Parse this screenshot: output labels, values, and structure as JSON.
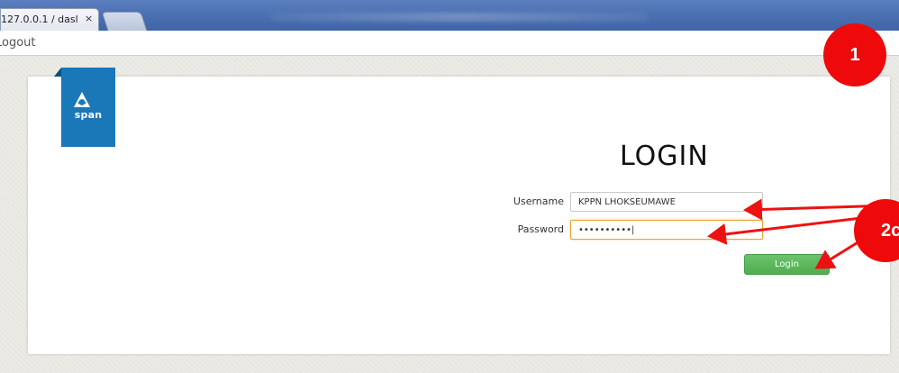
{
  "browser": {
    "tab_title": "127.0.0.1 / dasl",
    "tab_close": "×"
  },
  "topbar": {
    "logout_label": "Logout"
  },
  "brand": {
    "name": "span",
    "color": "#1a77b8"
  },
  "login": {
    "title": "LOGIN",
    "username_label": "Username",
    "username_value": "KPPN LHOKSEUMAWE",
    "password_label": "Password",
    "password_value": "••••••••••|",
    "button_label": "Login",
    "button_color": "#56b356"
  },
  "annotations": {
    "badge_1": "1",
    "badge_2": "2c",
    "color": "#ee0a0a"
  }
}
